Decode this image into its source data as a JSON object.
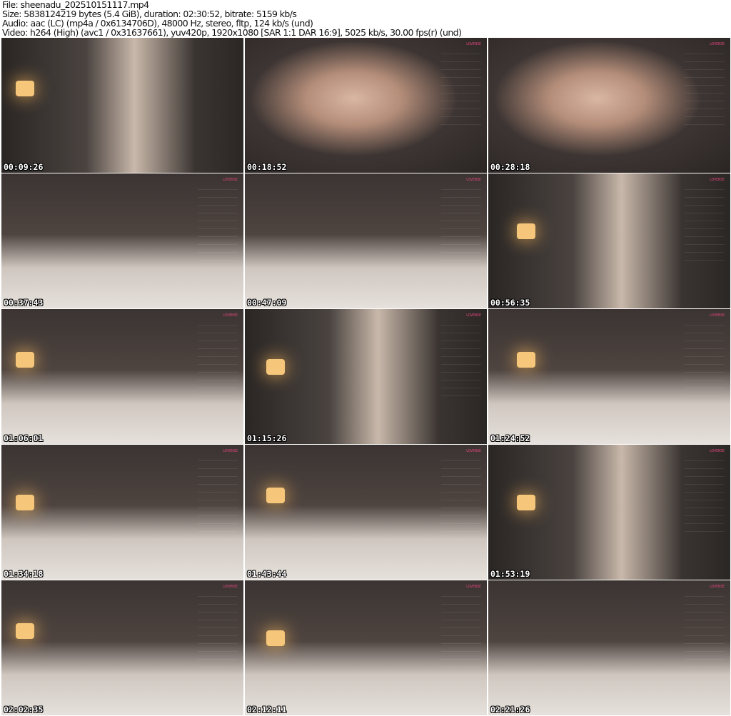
{
  "header": {
    "file": "File: sheenadu_202510151117.mp4",
    "size": "Size: 5838124219 bytes (5.4 GiB), duration: 02:30:52, bitrate: 5159 kb/s",
    "audio": "Audio: aac (LC) (mp4a / 0x6134706D), 48000 Hz, stereo, fltp, 124 kb/s (und)",
    "video": "Video: h264 (High) (avc1 / 0x31637661), yuv420p, 1920x1080 [SAR 1:1 DAR 16:9], 5025 kb/s, 30.00 fps(r) (und)"
  },
  "overlay_brand": "LOVENSE",
  "thumbnails": [
    {
      "timestamp": "00:09:26",
      "style": "a",
      "lamp": true,
      "panel": false
    },
    {
      "timestamp": "00:18:52",
      "style": "c",
      "lamp": false,
      "panel": true
    },
    {
      "timestamp": "00:28:18",
      "style": "c",
      "lamp": false,
      "panel": true
    },
    {
      "timestamp": "00:37:43",
      "style": "b",
      "lamp": false,
      "panel": true
    },
    {
      "timestamp": "00:47:09",
      "style": "b",
      "lamp": false,
      "panel": true
    },
    {
      "timestamp": "00:56:35",
      "style": "a",
      "lamp": true,
      "panel": true
    },
    {
      "timestamp": "01:06:01",
      "style": "b",
      "lamp": true,
      "panel": true
    },
    {
      "timestamp": "01:15:26",
      "style": "a",
      "lamp": true,
      "panel": true
    },
    {
      "timestamp": "01:24:52",
      "style": "b",
      "lamp": true,
      "panel": true
    },
    {
      "timestamp": "01:34:18",
      "style": "b",
      "lamp": true,
      "panel": true
    },
    {
      "timestamp": "01:43:44",
      "style": "b",
      "lamp": true,
      "panel": true
    },
    {
      "timestamp": "01:53:19",
      "style": "a",
      "lamp": true,
      "panel": true
    },
    {
      "timestamp": "02:02:35",
      "style": "b",
      "lamp": true,
      "panel": true
    },
    {
      "timestamp": "02:12:11",
      "style": "b",
      "lamp": true,
      "panel": true
    },
    {
      "timestamp": "02:21:26",
      "style": "b",
      "lamp": false,
      "panel": true
    }
  ]
}
